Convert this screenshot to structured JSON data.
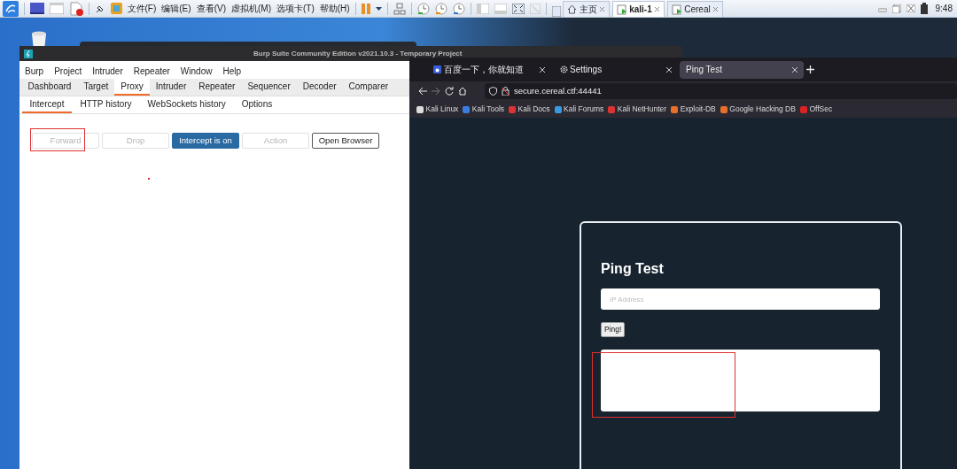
{
  "vm_toolbar": {
    "menus": [
      "文件(F)",
      "编辑(E)",
      "查看(V)",
      "虚拟机(M)",
      "选项卡(T)",
      "帮助(H)"
    ],
    "tabs": [
      {
        "label": "主页",
        "selected": false
      },
      {
        "label": "kali-1",
        "selected": true
      },
      {
        "label": "Cereal",
        "selected": false
      }
    ],
    "clock": "9:48"
  },
  "burp": {
    "title": "Burp Suite Community Edition v2021.10.3 - Temporary Project",
    "menu": [
      "Burp",
      "Project",
      "Intruder",
      "Repeater",
      "Window",
      "Help"
    ],
    "tabs": [
      {
        "label": "Dashboard",
        "selected": false
      },
      {
        "label": "Target",
        "selected": false
      },
      {
        "label": "Proxy",
        "selected": true
      },
      {
        "label": "Intruder",
        "selected": false
      },
      {
        "label": "Repeater",
        "selected": false
      },
      {
        "label": "Sequencer",
        "selected": false
      },
      {
        "label": "Decoder",
        "selected": false
      },
      {
        "label": "Comparer",
        "selected": false
      }
    ],
    "subtabs": [
      {
        "label": "Intercept",
        "selected": true
      },
      {
        "label": "HTTP history",
        "selected": false
      },
      {
        "label": "WebSockets history",
        "selected": false
      },
      {
        "label": "Options",
        "selected": false
      }
    ],
    "buttons": [
      {
        "label": "Forward",
        "disabled": true,
        "on": false,
        "highlighted": true
      },
      {
        "label": "Drop",
        "disabled": true,
        "on": false,
        "highlighted": false
      },
      {
        "label": "Intercept is on",
        "disabled": false,
        "on": true,
        "highlighted": false
      },
      {
        "label": "Action",
        "disabled": true,
        "on": false,
        "highlighted": false
      },
      {
        "label": "Open Browser",
        "disabled": false,
        "on": false,
        "highlighted": false
      }
    ]
  },
  "browser": {
    "tabs": [
      {
        "label": "百度一下，你就知道",
        "selected": false
      },
      {
        "label": "Settings",
        "selected": false
      },
      {
        "label": "Ping Test",
        "selected": true
      }
    ],
    "url": "secure.cereal.ctf:44441",
    "bookmarks": [
      "Kali Linux",
      "Kali Tools",
      "Kali Docs",
      "Kali Forums",
      "Kali NetHunter",
      "Exploit-DB",
      "Google Hacking DB",
      "OffSec"
    ],
    "page": {
      "heading": "Ping Test",
      "input": {
        "placeholder": "IP Address"
      },
      "button": "Ping!",
      "output": {
        "highlighted": true
      }
    }
  }
}
